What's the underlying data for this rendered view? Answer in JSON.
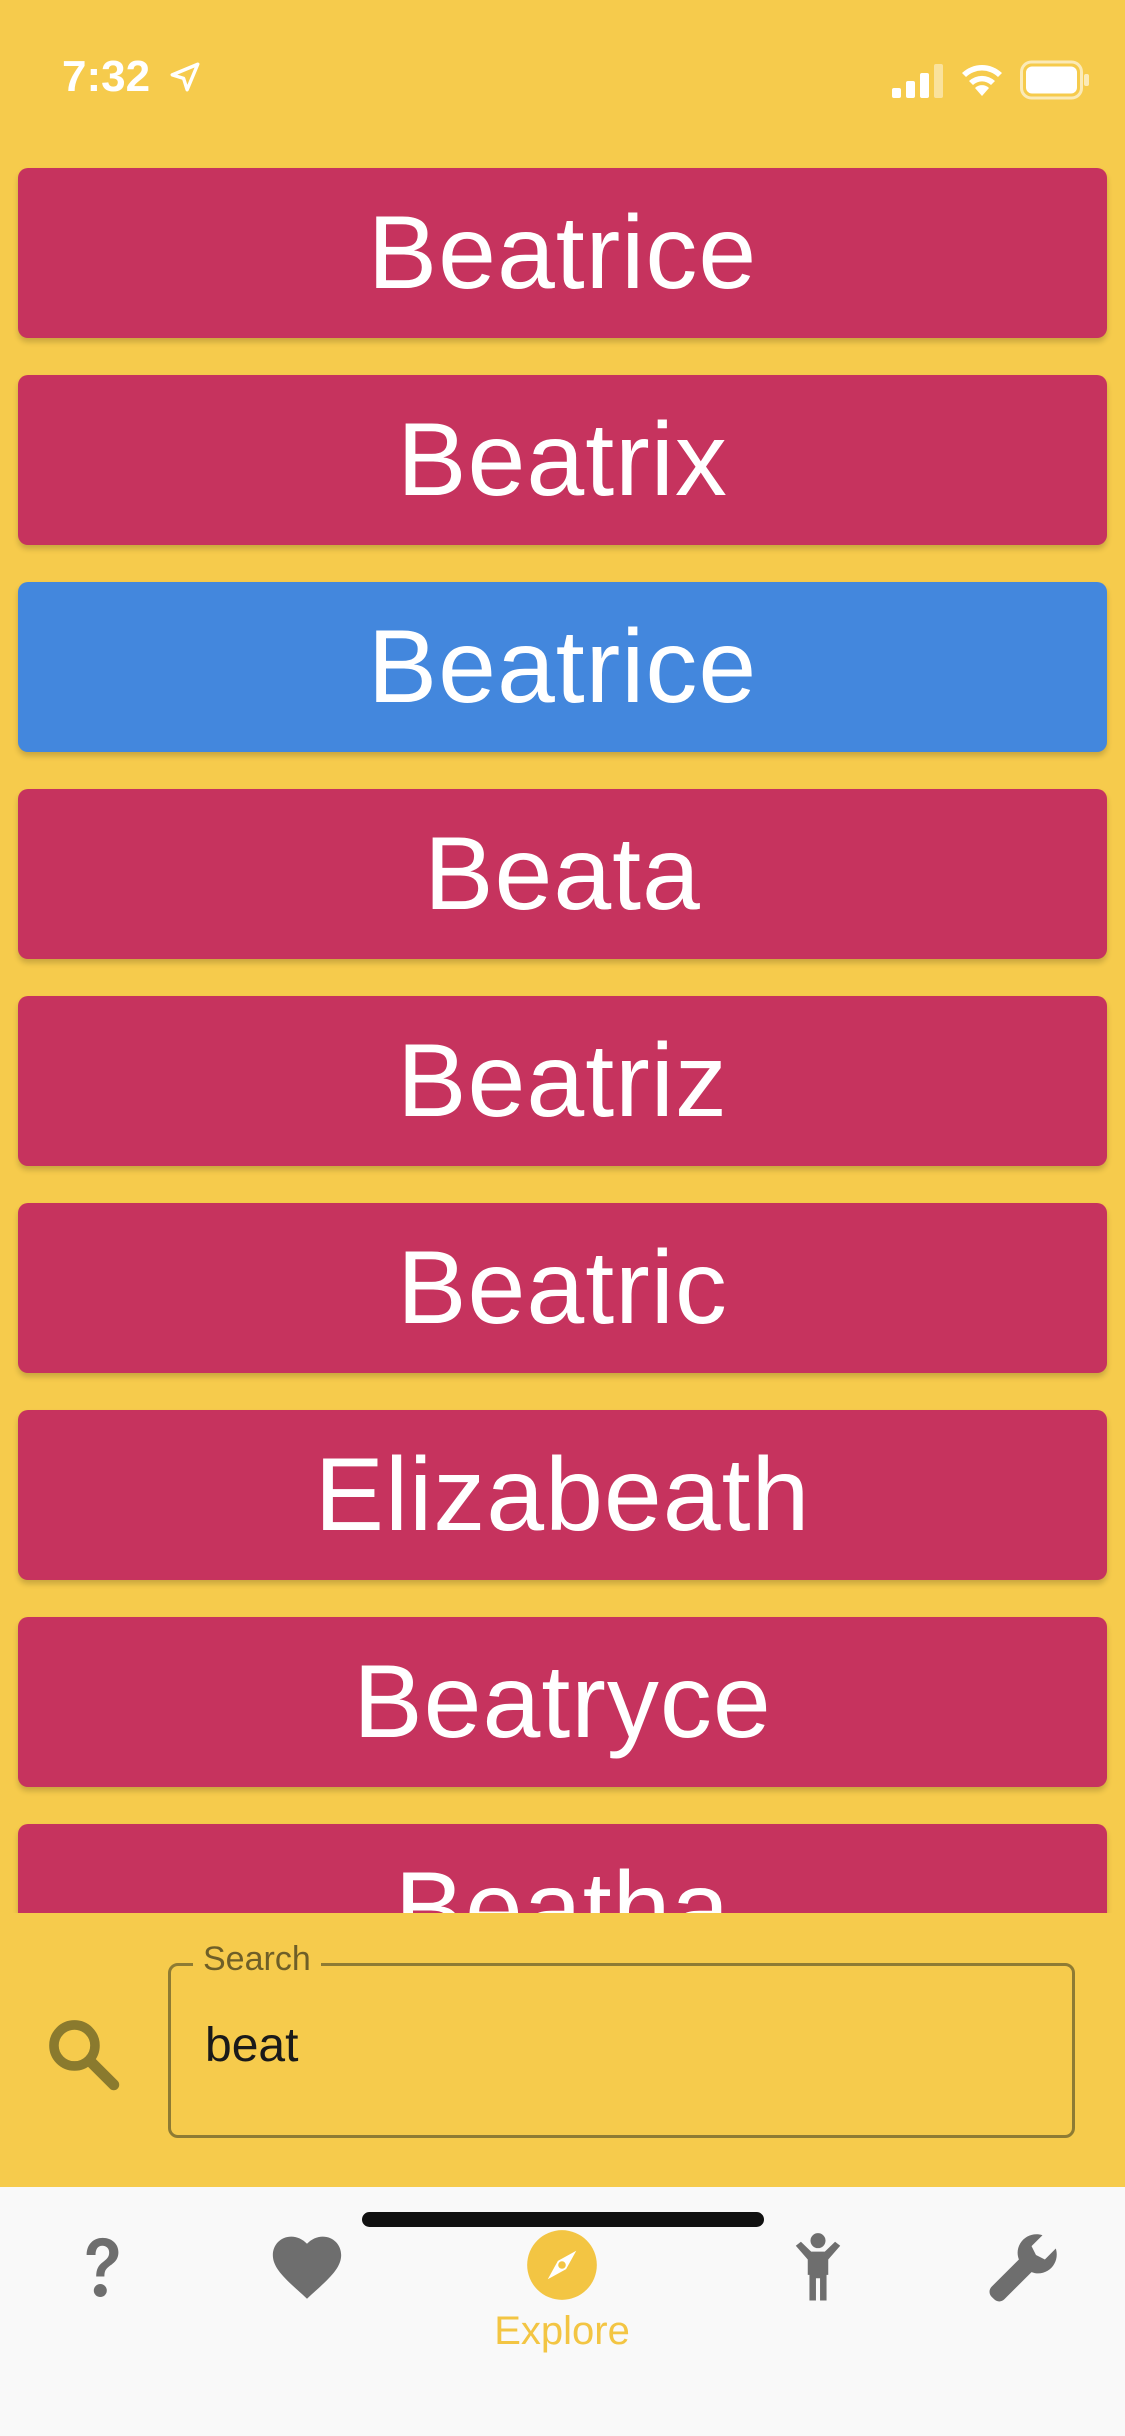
{
  "status_bar": {
    "time": "7:32"
  },
  "names": [
    {
      "label": "Beatrice",
      "selected": false
    },
    {
      "label": "Beatrix",
      "selected": false
    },
    {
      "label": "Beatrice",
      "selected": true
    },
    {
      "label": "Beata",
      "selected": false
    },
    {
      "label": "Beatriz",
      "selected": false
    },
    {
      "label": "Beatric",
      "selected": false
    },
    {
      "label": "Elizabeath",
      "selected": false
    },
    {
      "label": "Beatryce",
      "selected": false
    },
    {
      "label": "Beatha",
      "selected": false
    }
  ],
  "search": {
    "label": "Search",
    "value": "beat"
  },
  "nav": {
    "items": [
      {
        "icon": "question-icon",
        "label": ""
      },
      {
        "icon": "heart-icon",
        "label": ""
      },
      {
        "icon": "compass-icon",
        "label": "Explore",
        "active": true
      },
      {
        "icon": "child-icon",
        "label": ""
      },
      {
        "icon": "wrench-icon",
        "label": ""
      }
    ]
  },
  "colors": {
    "background": "#F6CB4C",
    "card": "#C6335E",
    "card_selected": "#4387DD",
    "nav_active": "#F3C543",
    "nav_inactive": "#6E6E6E"
  }
}
